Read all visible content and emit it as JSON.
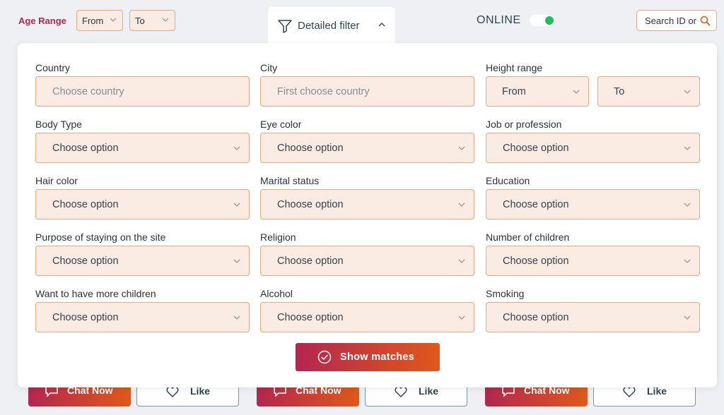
{
  "topbar": {
    "age_range_label": "Age Range",
    "age_from": "From",
    "age_to": "To",
    "detailed_filter_label": "Detailed filter",
    "online_label": "ONLINE",
    "online_enabled": true,
    "search_placeholder": "Search ID or"
  },
  "filters": {
    "country": {
      "label": "Country",
      "value": "Choose country"
    },
    "city": {
      "label": "City",
      "value": "First choose country"
    },
    "height": {
      "label": "Height range",
      "from": "From",
      "to": "To"
    },
    "body_type": {
      "label": "Body Type",
      "value": "Choose option"
    },
    "eye_color": {
      "label": "Eye color",
      "value": "Choose option"
    },
    "job": {
      "label": "Job or profession",
      "value": "Choose option"
    },
    "hair_color": {
      "label": "Hair color",
      "value": "Choose option"
    },
    "marital_status": {
      "label": "Marital status",
      "value": "Choose option"
    },
    "education": {
      "label": "Education",
      "value": "Choose option"
    },
    "purpose": {
      "label": "Purpose of staying on the site",
      "value": "Choose option"
    },
    "religion": {
      "label": "Religion",
      "value": "Choose option"
    },
    "children": {
      "label": "Number of children",
      "value": "Choose option"
    },
    "more_children": {
      "label": "Want to have more children",
      "value": "Choose option"
    },
    "alcohol": {
      "label": "Alcohol",
      "value": "Choose option"
    },
    "smoking": {
      "label": "Smoking",
      "value": "Choose option"
    }
  },
  "show_matches_label": "Show matches",
  "cards": {
    "chat_label": "Chat Now",
    "like_label": "Like"
  },
  "colors": {
    "accent_start": "#b3264f",
    "accent_end": "#e0591a",
    "field_bg": "#fbece3",
    "field_border": "#eba77e",
    "online_dot": "#1fbf5a"
  }
}
